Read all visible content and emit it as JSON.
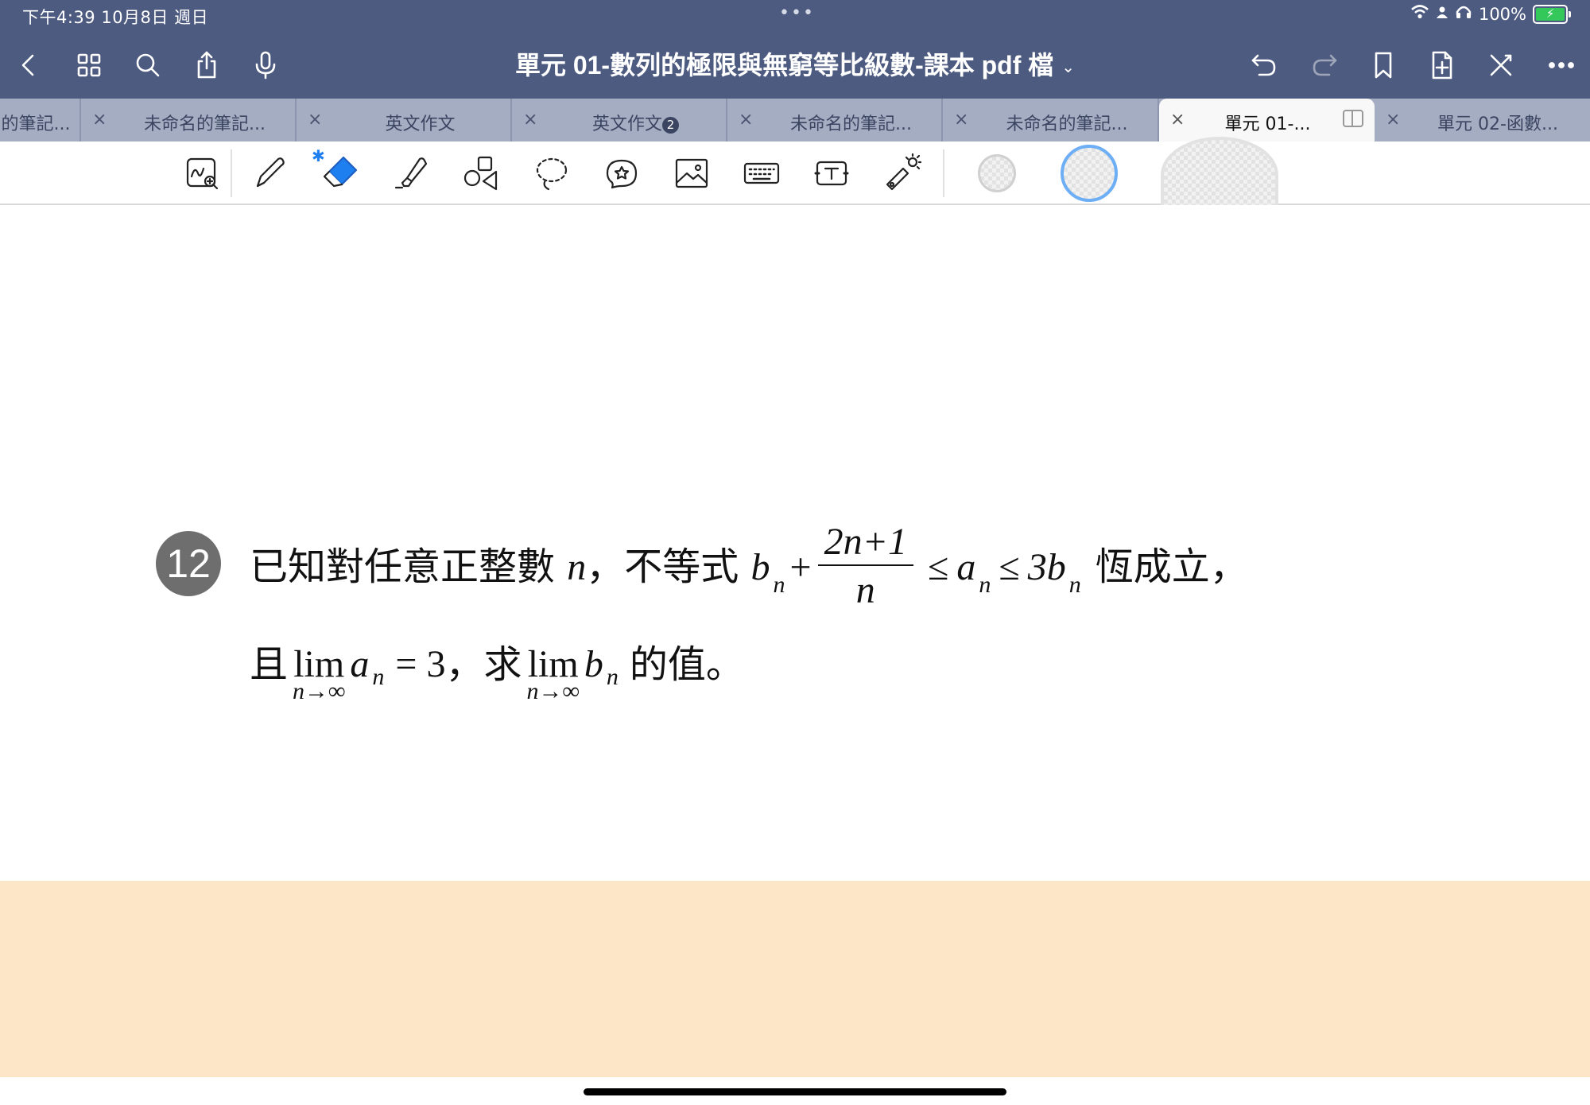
{
  "status_bar": {
    "time": "下午4:39   10月8日 週日",
    "battery": "100%"
  },
  "navbar": {
    "title": "單元 01-數列的極限與無窮等比級數-課本 pdf 檔",
    "title_chevron": "⌄",
    "icons": [
      "back-icon",
      "grid-icon",
      "search-icon",
      "share-icon",
      "microphone-icon",
      "undo-icon",
      "redo-icon",
      "bookmark-icon",
      "add-page-icon",
      "close-toolbar-icon",
      "more-icon"
    ]
  },
  "tabs": [
    {
      "label": "的筆記..."
    },
    {
      "label": "未命名的筆記..."
    },
    {
      "label": "英文作文"
    },
    {
      "label": "英文作文",
      "badge": "2"
    },
    {
      "label": "未命名的筆記..."
    },
    {
      "label": "未命名的筆記..."
    },
    {
      "label": "單元 01-...",
      "active": true
    },
    {
      "label": "單元 02-函數..."
    }
  ],
  "tab_close": "×",
  "toolbar": {
    "bluetooth": "✱",
    "tools": [
      "zoom-window",
      "pen",
      "eraser",
      "highlighter",
      "shapes",
      "lasso",
      "elements",
      "image",
      "keyboard",
      "text-box",
      "laser-pointer"
    ],
    "selected_tool": "eraser",
    "accent_color": "#1e7ff0"
  },
  "question": {
    "number": "12",
    "line1": {
      "t1": "已知對任意正整數 ",
      "n": "n",
      "t2": "，不等式 ",
      "b": "b",
      "sub_n": "n",
      "plus": "+",
      "frac_num": "2n+1",
      "frac_den": "n",
      "le1": "≤",
      "a": "a",
      "le2": "≤",
      "three_b": "3b",
      "t3": "恆成立，"
    },
    "line2": {
      "t1": "且",
      "lim": "lim",
      "lim_under": "n→∞",
      "a": "a",
      "sub_n": "n",
      "eq": "= 3",
      "t2": "，求",
      "b": "b",
      "t3": "的值。"
    }
  },
  "colors": {
    "chrome": "#4e5b80",
    "tab_inactive": "#a5adc2",
    "page_footer": "#fde5c8",
    "badge_circle": "#6e6e6e"
  }
}
